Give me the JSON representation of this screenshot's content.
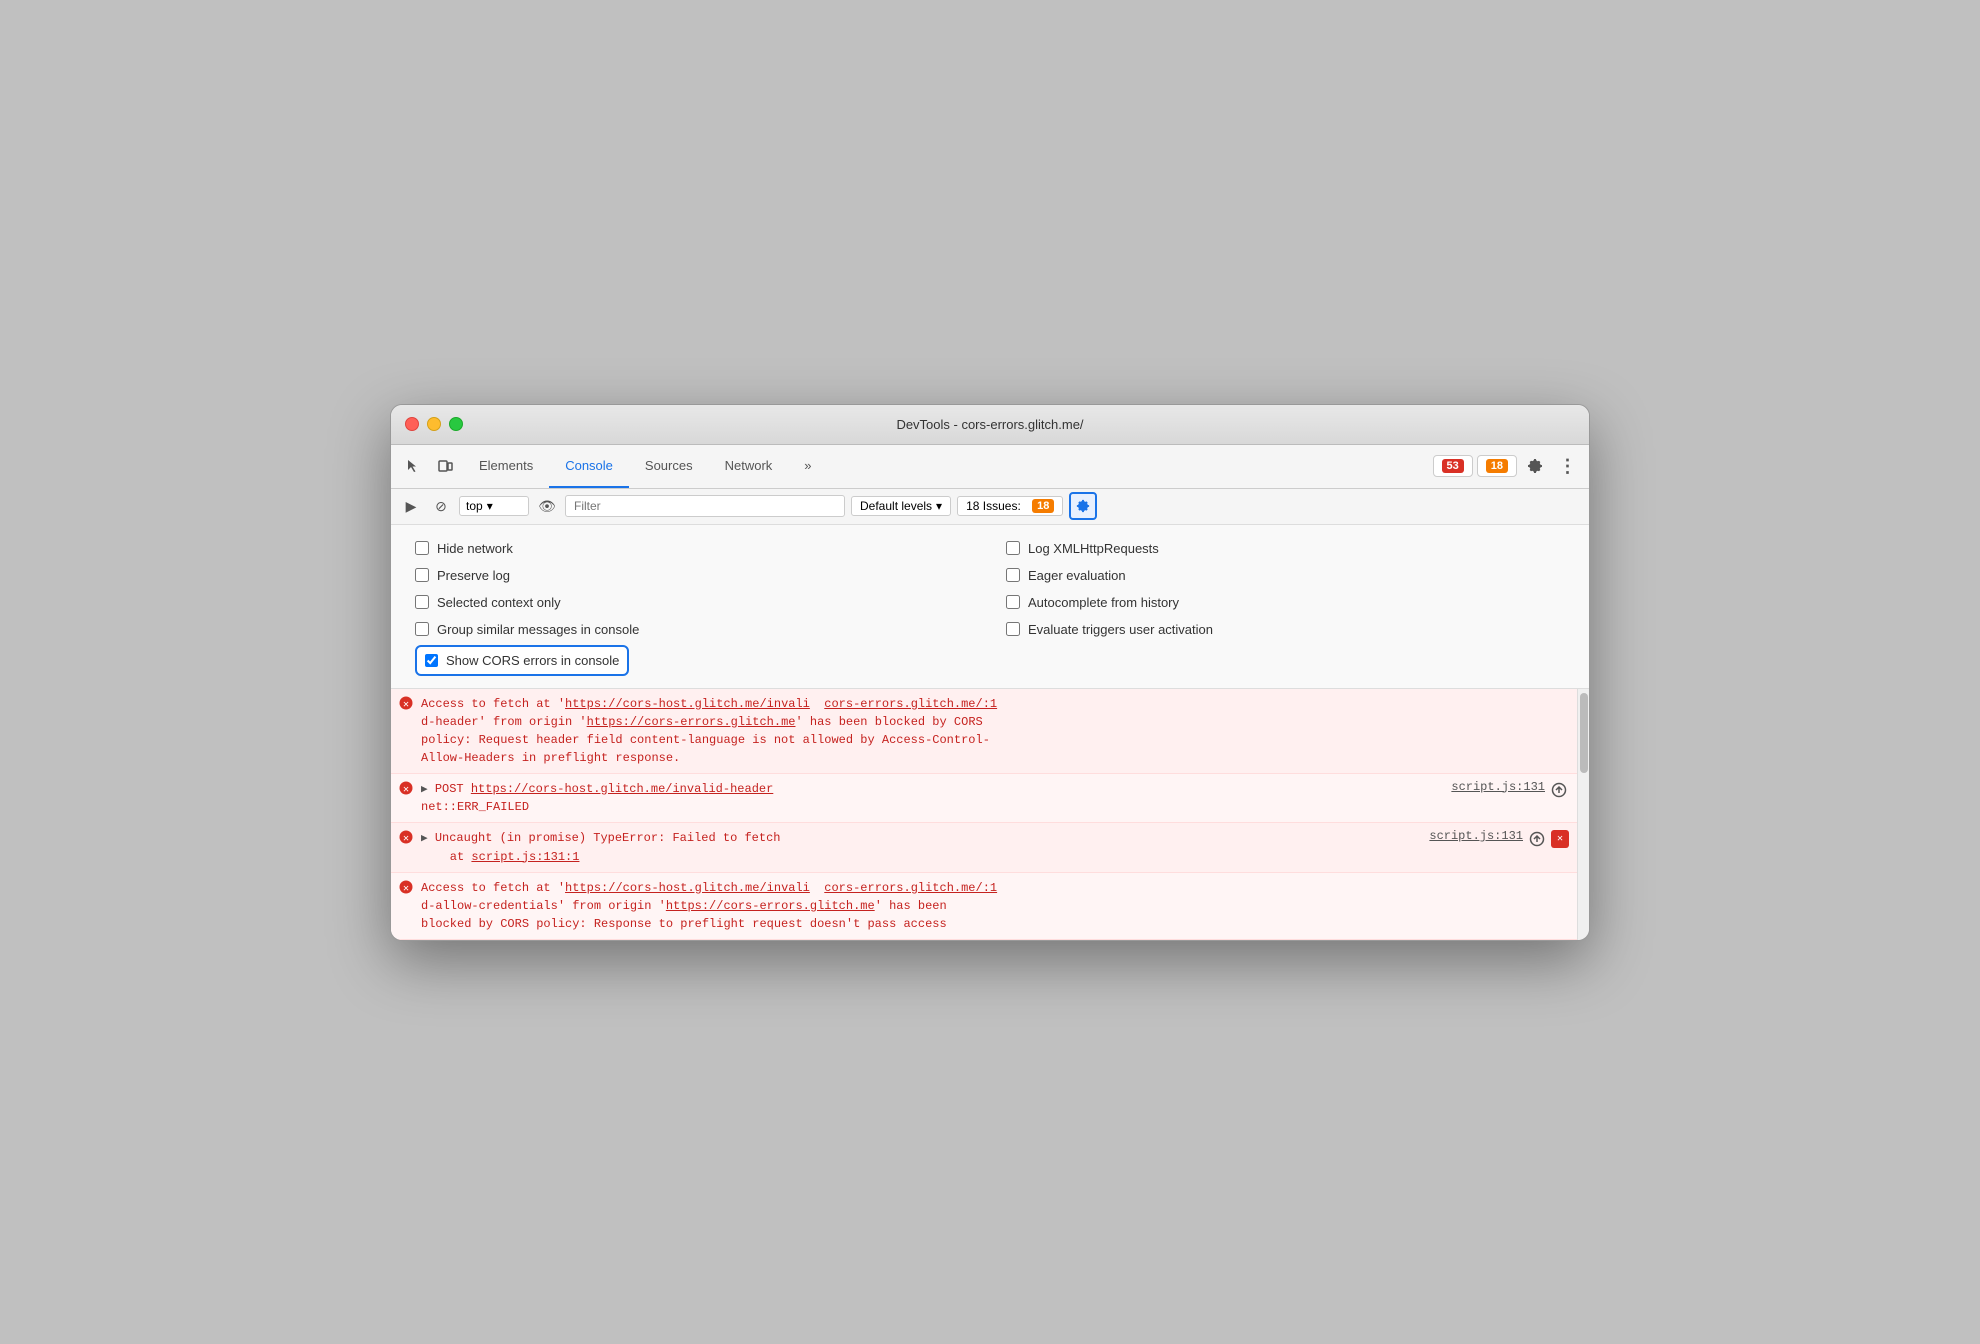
{
  "window": {
    "title": "DevTools - cors-errors.glitch.me/"
  },
  "tabs": [
    {
      "id": "elements",
      "label": "Elements",
      "active": false
    },
    {
      "id": "console",
      "label": "Console",
      "active": true
    },
    {
      "id": "sources",
      "label": "Sources",
      "active": false
    },
    {
      "id": "network",
      "label": "Network",
      "active": false
    }
  ],
  "toolbar": {
    "error_count": "53",
    "warning_count": "18",
    "more_label": "»",
    "gear_label": "⚙",
    "more_dots": "⋮"
  },
  "console_toolbar": {
    "play_icon": "▶",
    "block_icon": "⊘",
    "context_label": "top",
    "dropdown_arrow": "▾",
    "eye_icon": "👁",
    "filter_placeholder": "Filter",
    "levels_label": "Default levels",
    "levels_arrow": "▾",
    "issues_label": "18 Issues:",
    "issues_count": "18",
    "settings_icon": "⚙"
  },
  "settings": {
    "checkboxes_col1": [
      {
        "id": "hide-network",
        "label": "Hide network",
        "checked": false
      },
      {
        "id": "preserve-log",
        "label": "Preserve log",
        "checked": false
      },
      {
        "id": "selected-context",
        "label": "Selected context only",
        "checked": false
      },
      {
        "id": "group-similar",
        "label": "Group similar messages in console",
        "checked": false
      },
      {
        "id": "show-cors",
        "label": "Show CORS errors in console",
        "checked": true,
        "highlighted": true
      }
    ],
    "checkboxes_col2": [
      {
        "id": "log-xml",
        "label": "Log XMLHttpRequests",
        "checked": false
      },
      {
        "id": "eager-eval",
        "label": "Eager evaluation",
        "checked": false
      },
      {
        "id": "autocomplete",
        "label": "Autocomplete from history",
        "checked": false
      },
      {
        "id": "evaluate-triggers",
        "label": "Evaluate triggers user activation",
        "checked": false
      }
    ]
  },
  "console_entries": [
    {
      "id": "entry1",
      "type": "error",
      "message": "Access to fetch at 'https://cors-host.glitch.me/invali  cors-errors.glitch.me/:1\nd-header' from origin 'https://cors-errors.glitch.me' has been blocked by CORS\npolicy: Request header field content-language is not allowed by Access-Control-\nAllow-Headers in preflight response.",
      "link1": "https://cors-host.glitch.me/invali",
      "link2": "cors-errors.glitch.me/:1",
      "link3": "https://cors-errors.glitch.me",
      "has_source": false,
      "actions": []
    },
    {
      "id": "entry2",
      "type": "error",
      "message": "▶ POST https://cors-host.glitch.me/invalid-header\nnet::ERR_FAILED",
      "source": "script.js:131",
      "has_triangle": true,
      "actions": [
        "upload"
      ]
    },
    {
      "id": "entry3",
      "type": "error",
      "message": "▶ Uncaught (in promise) TypeError: Failed to fetch\n    at script.js:131:1",
      "source": "script.js:131",
      "has_triangle": true,
      "actions": [
        "upload",
        "close"
      ]
    },
    {
      "id": "entry4",
      "type": "error",
      "message": "Access to fetch at 'https://cors-host.glitch.me/invali  cors-errors.glitch.me/:1\nd-allow-credentials' from origin 'https://cors-errors.glitch.me' has been\nblocked by CORS policy: Response to preflight request doesn't pass access",
      "link1": "https://cors-host.glitch.me/invali",
      "link2": "cors-errors.glitch.me/:1",
      "link3": "https://cors-errors.glitch.me",
      "has_source": false,
      "actions": []
    }
  ]
}
